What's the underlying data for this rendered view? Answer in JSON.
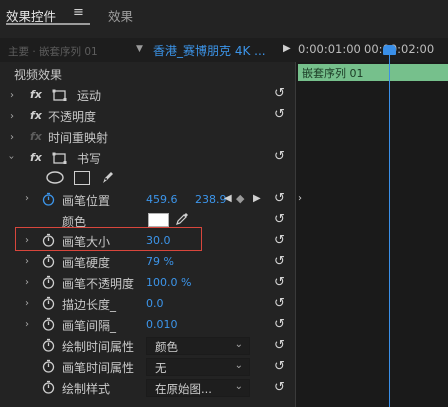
{
  "tabs": {
    "effect_controls": "效果控件",
    "menu_icon": "≡",
    "effects": "效果"
  },
  "header": {
    "master": "主要 · 嵌套序列 01",
    "clip": "香港_赛博朋克 4K ...",
    "timecode_1": "0:00:01:00",
    "timecode_2": "00:00:02:00"
  },
  "timeline": {
    "clip_label": "嵌套序列 01"
  },
  "section": {
    "video_effects": "视频效果"
  },
  "effects": {
    "motion": "运动",
    "opacity": "不透明度",
    "time_remap": "时间重映射",
    "write": "书写"
  },
  "params": {
    "brush_position_label": "画笔位置",
    "brush_position_x": "459.6",
    "brush_position_y": "238.9",
    "color_label": "颜色",
    "brush_size_label": "画笔大小",
    "brush_size_value": "30.0",
    "brush_hardness_label": "画笔硬度",
    "brush_hardness_value": "79 %",
    "brush_opacity_label": "画笔不透明度",
    "brush_opacity_value": "100.0 %",
    "stroke_length_label": "描边长度_",
    "stroke_length_value": "0.0",
    "brush_spacing_label": "画笔间隔_",
    "brush_spacing_value": "0.010",
    "paint_time_prop_label": "绘制时间属性",
    "paint_time_prop_value": "颜色",
    "brush_time_prop_label": "画笔时间属性",
    "brush_time_prop_value": "无",
    "paint_style_label": "绘制样式",
    "paint_style_value": "在原始图..."
  },
  "colors": {
    "accent_blue": "#3c95ea",
    "timeline_clip_green": "#76c08c",
    "highlight_red": "#d8463c"
  }
}
